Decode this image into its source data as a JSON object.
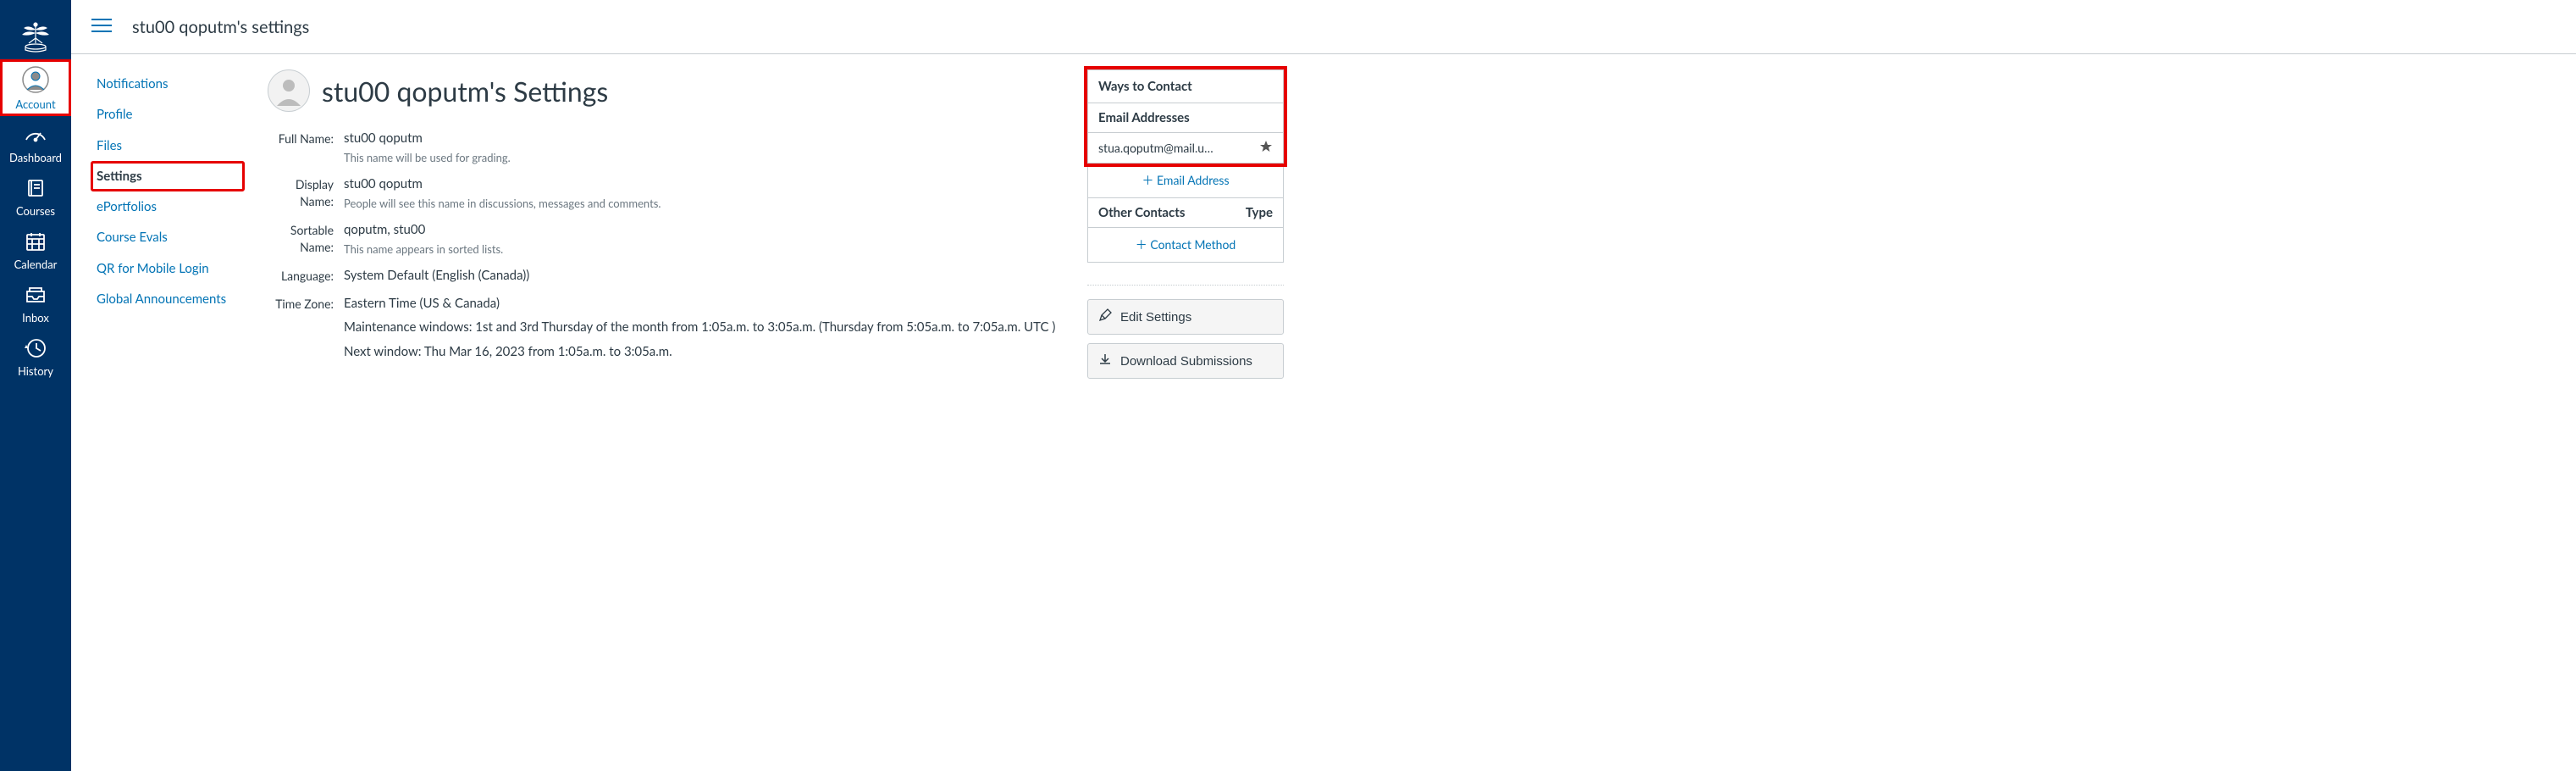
{
  "breadcrumb": "stu00 qoputm's settings",
  "global_nav": {
    "account": "Account",
    "dashboard": "Dashboard",
    "courses": "Courses",
    "calendar": "Calendar",
    "inbox": "Inbox",
    "history": "History"
  },
  "context_nav": {
    "notifications": "Notifications",
    "profile": "Profile",
    "files": "Files",
    "settings": "Settings",
    "eportfolios": "ePortfolios",
    "course_evals": "Course Evals",
    "qr_mobile": "QR for Mobile Login",
    "global_announce": "Global Announcements"
  },
  "page_title": "stu00 qoputm's Settings",
  "fields": {
    "full_name": {
      "label": "Full Name:",
      "value": "stu00 qoputm",
      "hint": "This name will be used for grading."
    },
    "display_name": {
      "label": "Display Name:",
      "value": "stu00 qoputm",
      "hint": "People will see this name in discussions, messages and comments."
    },
    "sortable_name": {
      "label": "Sortable Name:",
      "value": "qoputm, stu00",
      "hint": "This name appears in sorted lists."
    },
    "language": {
      "label": "Language:",
      "value": "System Default (English (Canada))"
    },
    "time_zone": {
      "label": "Time Zone:",
      "value": "Eastern Time (US & Canada)",
      "maintenance": "Maintenance windows: 1st and 3rd Thursday of the month from 1:05a.m. to 3:05a.m. (Thursday from 5:05a.m. to 7:05a.m. UTC )",
      "next_window": "Next window: Thu Mar 16, 2023 from 1:05a.m. to 3:05a.m."
    }
  },
  "contact": {
    "title": "Ways to Contact",
    "email_header": "Email Addresses",
    "email_value": "stua.qoputm@mail.u…",
    "add_email": "Email Address",
    "other_header": "Other Contacts",
    "type_header": "Type",
    "add_contact": "Contact Method"
  },
  "actions": {
    "edit_settings": "Edit Settings",
    "download_subs": "Download Submissions"
  }
}
